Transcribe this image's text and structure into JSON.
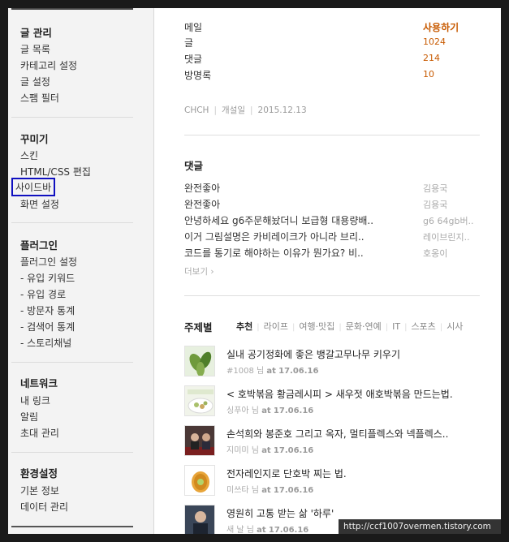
{
  "sidebar": {
    "groups": [
      {
        "title": "글 관리",
        "items": [
          "글 목록",
          "카테고리 설정",
          "글 설정",
          "스팸 필터"
        ]
      },
      {
        "title": "꾸미기",
        "items": [
          "스킨",
          "HTML/CSS 편집",
          "사이드바",
          "화면 설정"
        ]
      },
      {
        "title": "플러그인",
        "items": [
          "플러그인 설정",
          "- 유입 키워드",
          "- 유입 경로",
          "- 방문자 통계",
          "- 검색어 통계",
          "- 스토리채널"
        ]
      },
      {
        "title": "네트워크",
        "items": [
          "내 링크",
          "알림",
          "초대 관리"
        ]
      },
      {
        "title": "환경설정",
        "items": [
          "기본 정보",
          "데이터 관리"
        ]
      }
    ]
  },
  "stats": [
    {
      "label": "메일",
      "value": "사용하기"
    },
    {
      "label": "글",
      "value": "1024"
    },
    {
      "label": "댓글",
      "value": "214"
    },
    {
      "label": "방명록",
      "value": "10"
    }
  ],
  "meta": {
    "name": "CHCH",
    "opened_label": "개설일",
    "date": "2015.12.13"
  },
  "comments": {
    "title": "댓글",
    "items": [
      {
        "text": "완전좋아",
        "author": "김용국"
      },
      {
        "text": "완전좋아",
        "author": "김용국"
      },
      {
        "text": "안녕하세요 g6주문해놨더니 보급형 대용량배..",
        "author": "g6 64gb버.."
      },
      {
        "text": "이거 그림설명은 카비레이크가 아니라 브리..",
        "author": "레이브린지.."
      },
      {
        "text": "코드를 통기로 해야하는 이유가 뭔가요? 비..",
        "author": "호옹이"
      }
    ],
    "more": "더보기 ›"
  },
  "topics": {
    "title": "주제별",
    "tabs": [
      "추천",
      "라이프",
      "여행·맛집",
      "문화·연예",
      "IT",
      "스포츠",
      "시사"
    ],
    "posts": [
      {
        "title": "실내 공기정화에 좋은 뱅갈고무나무 키우기",
        "author": "#1008",
        "date": "17.06.16"
      },
      {
        "title": "< 호박볶음 황금레시피 > 새우젓 애호박볶음 만드는법.",
        "author": "싱푸아",
        "date": "17.06.16"
      },
      {
        "title": "손석희와 봉준호 그리고 옥자, 멀티플렉스와 넥플렉스..",
        "author": "지미미",
        "date": "17.06.16"
      },
      {
        "title": "전자레인지로 단호박 찌는 법.",
        "author": "미쓰타",
        "date": "17.06.16"
      },
      {
        "title": "영원히 고통 받는 삶 '하루'",
        "author": "새 날",
        "date": "17.06.16"
      }
    ],
    "by_label": "님",
    "at_label": "at"
  },
  "url_overlay": "http://ccf1007overmen.tistory.com",
  "colors": {
    "accent": "#c85a00",
    "highlight_box": "#1010c0"
  }
}
